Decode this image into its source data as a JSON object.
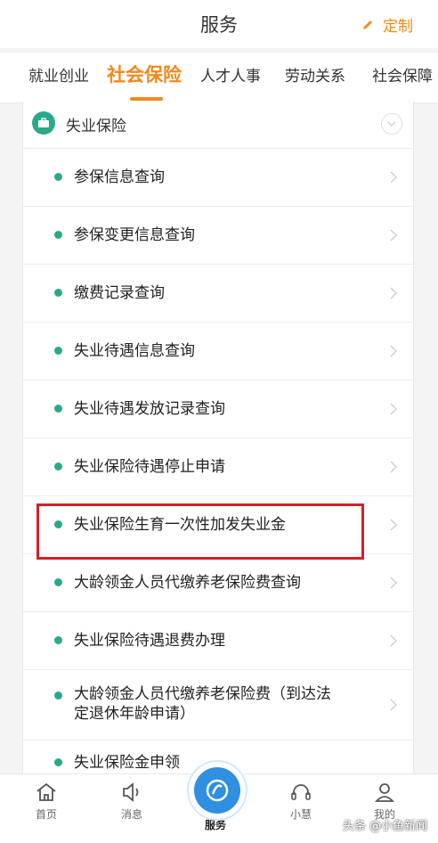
{
  "header": {
    "title": "服务",
    "customize_label": "定制"
  },
  "tabs": [
    {
      "label": "就业创业",
      "active": false
    },
    {
      "label": "社会保险",
      "active": true
    },
    {
      "label": "人才人事",
      "active": false
    },
    {
      "label": "劳动关系",
      "active": false
    },
    {
      "label": "社会保障",
      "active": false
    }
  ],
  "section": {
    "title": "失业保险",
    "icon": "briefcase-icon"
  },
  "items": [
    {
      "label": "参保信息查询"
    },
    {
      "label": "参保变更信息查询"
    },
    {
      "label": "缴费记录查询"
    },
    {
      "label": "失业待遇信息查询"
    },
    {
      "label": "失业待遇发放记录查询"
    },
    {
      "label": "失业保险待遇停止申请"
    },
    {
      "label": "失业保险生育一次性加发失业金",
      "highlighted": true
    },
    {
      "label": "大龄领金人员代缴养老保险费查询"
    },
    {
      "label": "失业保险待遇退费办理"
    },
    {
      "label": "大龄领金人员代缴养老保险费（到达法定退休年龄申请）"
    },
    {
      "label": "失业保险金申领"
    }
  ],
  "bottom_nav": [
    {
      "label": "首页",
      "icon": "home-icon"
    },
    {
      "label": "消息",
      "icon": "speaker-icon"
    },
    {
      "label": "服务",
      "icon": "service-logo-icon",
      "active": true
    },
    {
      "label": "小慧",
      "icon": "headset-icon"
    },
    {
      "label": "我的",
      "icon": "user-icon"
    }
  ],
  "watermark": "头条 @小鱼新闻",
  "colors": {
    "accent": "#f08a1c",
    "green": "#2aa98a",
    "highlight_border": "#d61f26",
    "nav_blue": "#2f8fe0"
  }
}
